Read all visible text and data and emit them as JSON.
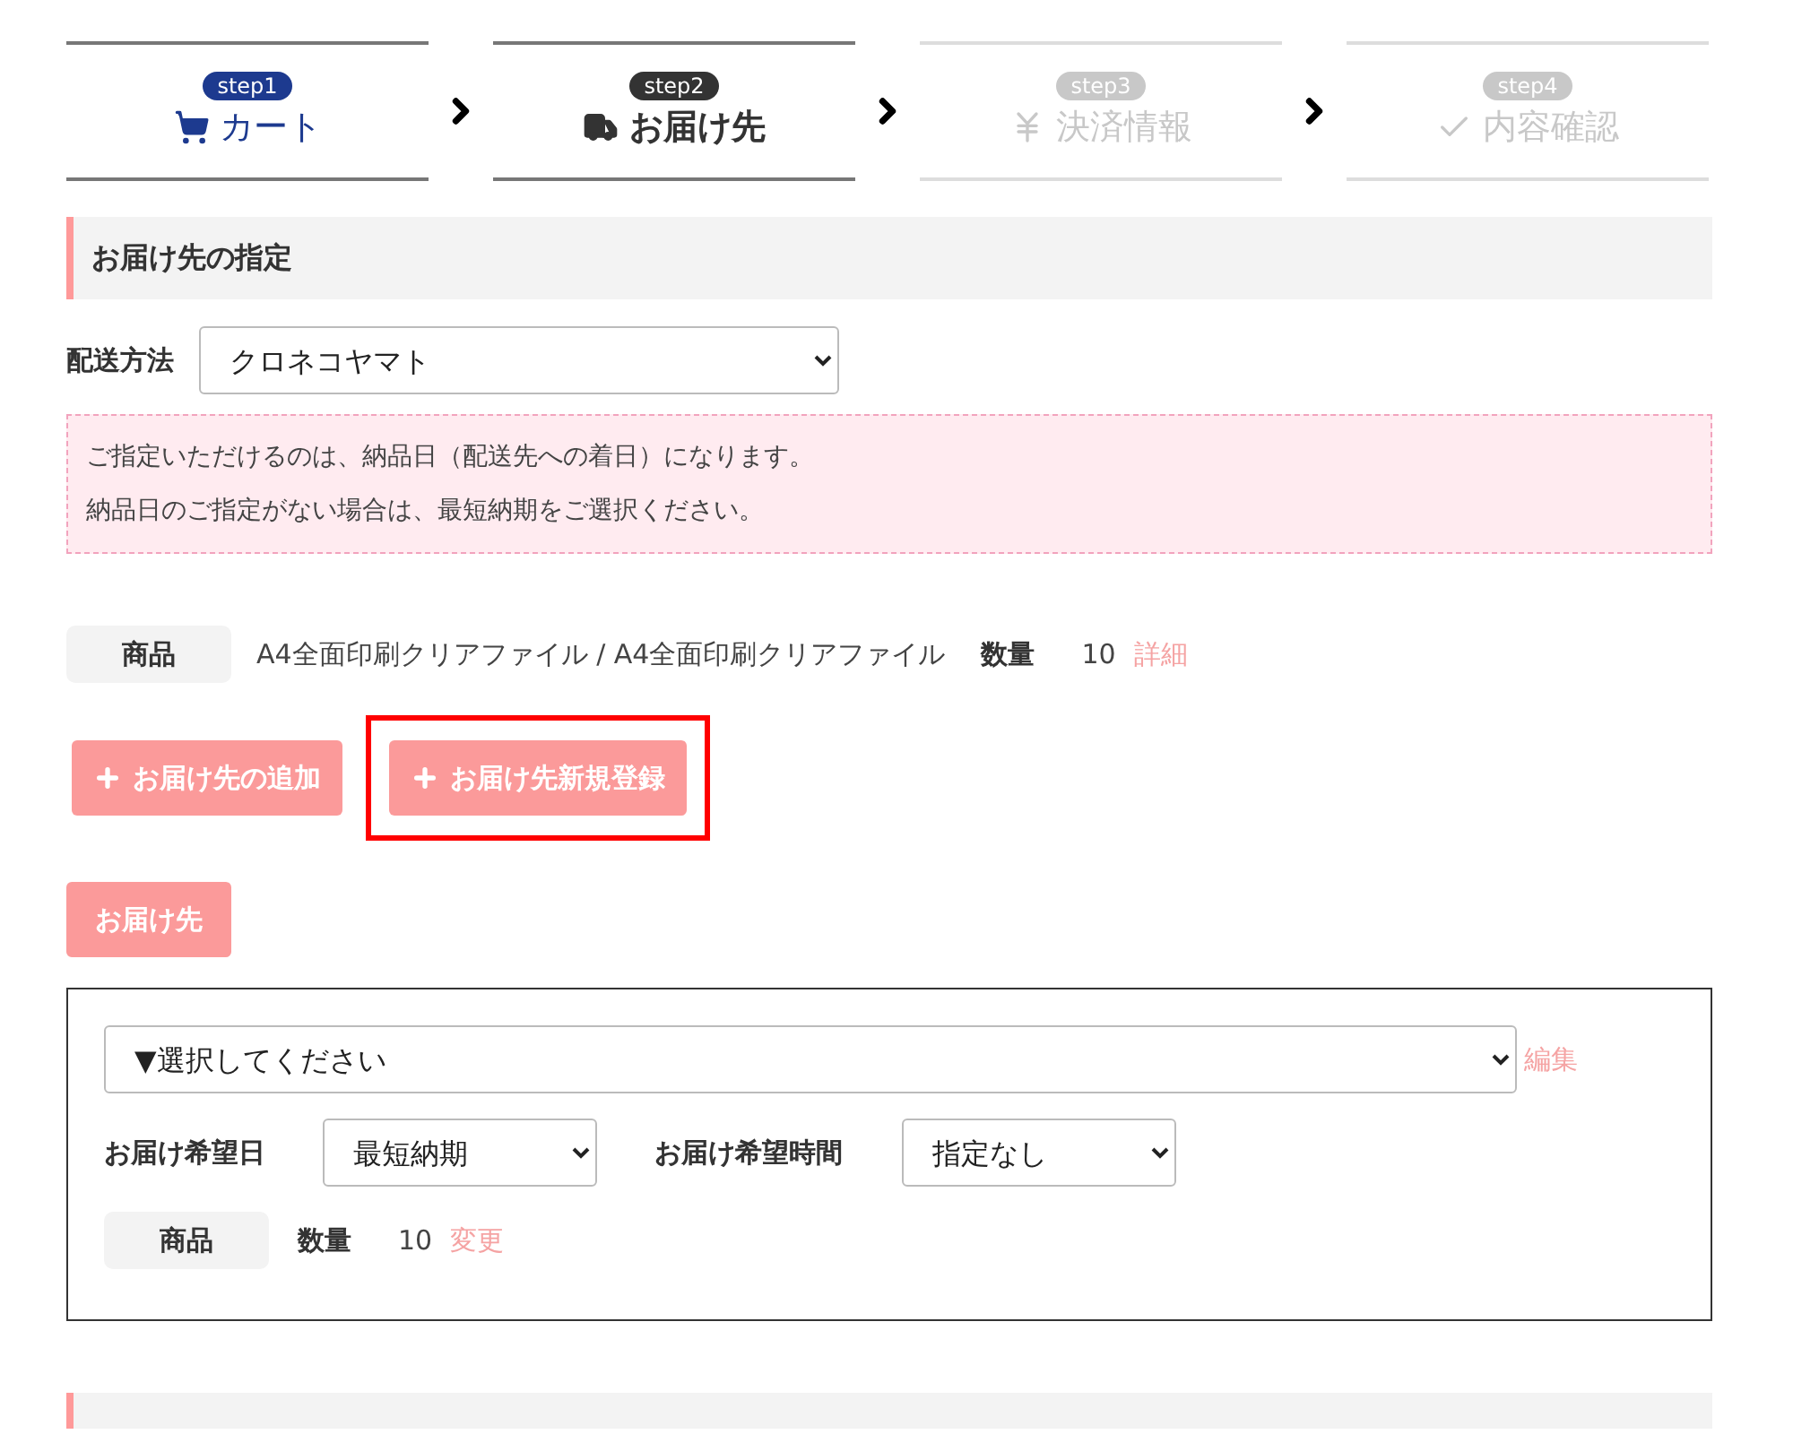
{
  "steps": [
    {
      "badge": "step1",
      "label": "カート",
      "kind": "done"
    },
    {
      "badge": "step2",
      "label": "お届け先",
      "kind": "current"
    },
    {
      "badge": "step3",
      "label": "決済情報",
      "kind": "upcoming"
    },
    {
      "badge": "step4",
      "label": "内容確認",
      "kind": "upcoming"
    }
  ],
  "section_title": "お届け先の指定",
  "shipping": {
    "label": "配送方法",
    "value": "クロネコヤマト"
  },
  "notice": [
    "ご指定いただけるのは、納品日（配送先への着日）になります。",
    "納品日のご指定がない場合は、最短納期をご選択ください。"
  ],
  "product": {
    "label": "商品",
    "name": "A4全面印刷クリアファイル / A4全面印刷クリアファイル",
    "qty_label": "数量",
    "qty": "10",
    "link": "詳細"
  },
  "actions": [
    {
      "label": "お届け先の追加",
      "highlighted": false
    },
    {
      "label": "お届け先新規登録",
      "highlighted": true
    }
  ],
  "destination_button": "お届け先",
  "destination": {
    "address_value": "▼選択してください",
    "edit_link": "編集",
    "date_label": "お届け希望日",
    "date_value": "最短納期",
    "time_label": "お届け希望時間",
    "time_value": "指定なし",
    "product_label": "商品",
    "qty_label": "数量",
    "qty": "10",
    "change_link": "変更"
  }
}
